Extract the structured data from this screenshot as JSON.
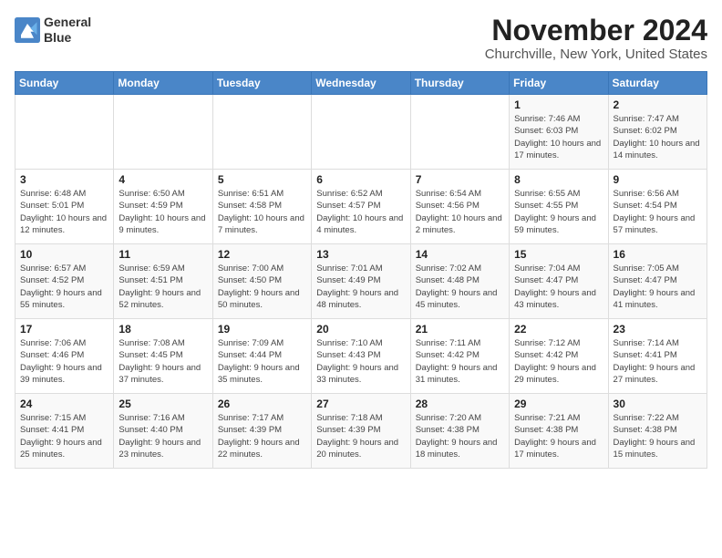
{
  "header": {
    "logo_line1": "General",
    "logo_line2": "Blue",
    "month": "November 2024",
    "location": "Churchville, New York, United States"
  },
  "weekdays": [
    "Sunday",
    "Monday",
    "Tuesday",
    "Wednesday",
    "Thursday",
    "Friday",
    "Saturday"
  ],
  "weeks": [
    [
      {
        "day": "",
        "info": ""
      },
      {
        "day": "",
        "info": ""
      },
      {
        "day": "",
        "info": ""
      },
      {
        "day": "",
        "info": ""
      },
      {
        "day": "",
        "info": ""
      },
      {
        "day": "1",
        "info": "Sunrise: 7:46 AM\nSunset: 6:03 PM\nDaylight: 10 hours and 17 minutes."
      },
      {
        "day": "2",
        "info": "Sunrise: 7:47 AM\nSunset: 6:02 PM\nDaylight: 10 hours and 14 minutes."
      }
    ],
    [
      {
        "day": "3",
        "info": "Sunrise: 6:48 AM\nSunset: 5:01 PM\nDaylight: 10 hours and 12 minutes."
      },
      {
        "day": "4",
        "info": "Sunrise: 6:50 AM\nSunset: 4:59 PM\nDaylight: 10 hours and 9 minutes."
      },
      {
        "day": "5",
        "info": "Sunrise: 6:51 AM\nSunset: 4:58 PM\nDaylight: 10 hours and 7 minutes."
      },
      {
        "day": "6",
        "info": "Sunrise: 6:52 AM\nSunset: 4:57 PM\nDaylight: 10 hours and 4 minutes."
      },
      {
        "day": "7",
        "info": "Sunrise: 6:54 AM\nSunset: 4:56 PM\nDaylight: 10 hours and 2 minutes."
      },
      {
        "day": "8",
        "info": "Sunrise: 6:55 AM\nSunset: 4:55 PM\nDaylight: 9 hours and 59 minutes."
      },
      {
        "day": "9",
        "info": "Sunrise: 6:56 AM\nSunset: 4:54 PM\nDaylight: 9 hours and 57 minutes."
      }
    ],
    [
      {
        "day": "10",
        "info": "Sunrise: 6:57 AM\nSunset: 4:52 PM\nDaylight: 9 hours and 55 minutes."
      },
      {
        "day": "11",
        "info": "Sunrise: 6:59 AM\nSunset: 4:51 PM\nDaylight: 9 hours and 52 minutes."
      },
      {
        "day": "12",
        "info": "Sunrise: 7:00 AM\nSunset: 4:50 PM\nDaylight: 9 hours and 50 minutes."
      },
      {
        "day": "13",
        "info": "Sunrise: 7:01 AM\nSunset: 4:49 PM\nDaylight: 9 hours and 48 minutes."
      },
      {
        "day": "14",
        "info": "Sunrise: 7:02 AM\nSunset: 4:48 PM\nDaylight: 9 hours and 45 minutes."
      },
      {
        "day": "15",
        "info": "Sunrise: 7:04 AM\nSunset: 4:47 PM\nDaylight: 9 hours and 43 minutes."
      },
      {
        "day": "16",
        "info": "Sunrise: 7:05 AM\nSunset: 4:47 PM\nDaylight: 9 hours and 41 minutes."
      }
    ],
    [
      {
        "day": "17",
        "info": "Sunrise: 7:06 AM\nSunset: 4:46 PM\nDaylight: 9 hours and 39 minutes."
      },
      {
        "day": "18",
        "info": "Sunrise: 7:08 AM\nSunset: 4:45 PM\nDaylight: 9 hours and 37 minutes."
      },
      {
        "day": "19",
        "info": "Sunrise: 7:09 AM\nSunset: 4:44 PM\nDaylight: 9 hours and 35 minutes."
      },
      {
        "day": "20",
        "info": "Sunrise: 7:10 AM\nSunset: 4:43 PM\nDaylight: 9 hours and 33 minutes."
      },
      {
        "day": "21",
        "info": "Sunrise: 7:11 AM\nSunset: 4:42 PM\nDaylight: 9 hours and 31 minutes."
      },
      {
        "day": "22",
        "info": "Sunrise: 7:12 AM\nSunset: 4:42 PM\nDaylight: 9 hours and 29 minutes."
      },
      {
        "day": "23",
        "info": "Sunrise: 7:14 AM\nSunset: 4:41 PM\nDaylight: 9 hours and 27 minutes."
      }
    ],
    [
      {
        "day": "24",
        "info": "Sunrise: 7:15 AM\nSunset: 4:41 PM\nDaylight: 9 hours and 25 minutes."
      },
      {
        "day": "25",
        "info": "Sunrise: 7:16 AM\nSunset: 4:40 PM\nDaylight: 9 hours and 23 minutes."
      },
      {
        "day": "26",
        "info": "Sunrise: 7:17 AM\nSunset: 4:39 PM\nDaylight: 9 hours and 22 minutes."
      },
      {
        "day": "27",
        "info": "Sunrise: 7:18 AM\nSunset: 4:39 PM\nDaylight: 9 hours and 20 minutes."
      },
      {
        "day": "28",
        "info": "Sunrise: 7:20 AM\nSunset: 4:38 PM\nDaylight: 9 hours and 18 minutes."
      },
      {
        "day": "29",
        "info": "Sunrise: 7:21 AM\nSunset: 4:38 PM\nDaylight: 9 hours and 17 minutes."
      },
      {
        "day": "30",
        "info": "Sunrise: 7:22 AM\nSunset: 4:38 PM\nDaylight: 9 hours and 15 minutes."
      }
    ]
  ]
}
